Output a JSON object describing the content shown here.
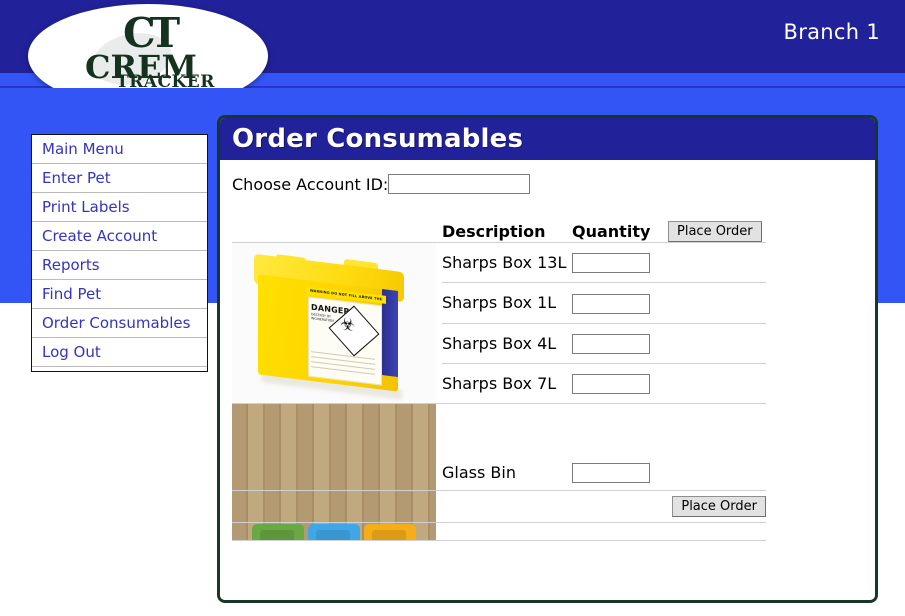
{
  "header": {
    "branch_label": "Branch 1",
    "logo": {
      "monogram": "CT",
      "word1": "CREM",
      "word2": "TRACKER"
    },
    "colors": {
      "header_navy": "#21219a",
      "body_blue": "#3355f5",
      "panel_border": "#173824"
    }
  },
  "sidebar": {
    "items": [
      {
        "label": "Main Menu"
      },
      {
        "label": "Enter Pet"
      },
      {
        "label": "Print Labels"
      },
      {
        "label": "Create Account"
      },
      {
        "label": "Reports"
      },
      {
        "label": "Find Pet"
      },
      {
        "label": "Order Consumables"
      },
      {
        "label": "Log Out"
      }
    ]
  },
  "panel": {
    "title": "Order Consumables",
    "account": {
      "label": "Choose Account ID:",
      "value": "",
      "placeholder": ""
    },
    "table": {
      "headers": {
        "image": "",
        "description": "Description",
        "quantity": "Quantity",
        "action": "Place Order"
      },
      "groups": [
        {
          "image_name": "sharps-box-photo",
          "image_alt": "Yellow sharps disposal container",
          "image_text": {
            "warning": "WARNING DO NOT FILL ABOVE THE LINE",
            "danger": "DANGER",
            "subtitle": "DESTROY BY INCINERATION"
          },
          "rows": [
            {
              "description": "Sharps Box 13L",
              "quantity": ""
            },
            {
              "description": "Sharps Box 1L",
              "quantity": ""
            },
            {
              "description": "Sharps Box 4L",
              "quantity": ""
            },
            {
              "description": "Sharps Box 7L",
              "quantity": ""
            }
          ]
        },
        {
          "image_name": "glass-bin-photo",
          "image_alt": "Green, blue and orange waste bins on wooden background",
          "rows": [
            {
              "description": "Glass Bin",
              "quantity": ""
            }
          ]
        }
      ]
    },
    "bottom_button": "Place Order"
  }
}
